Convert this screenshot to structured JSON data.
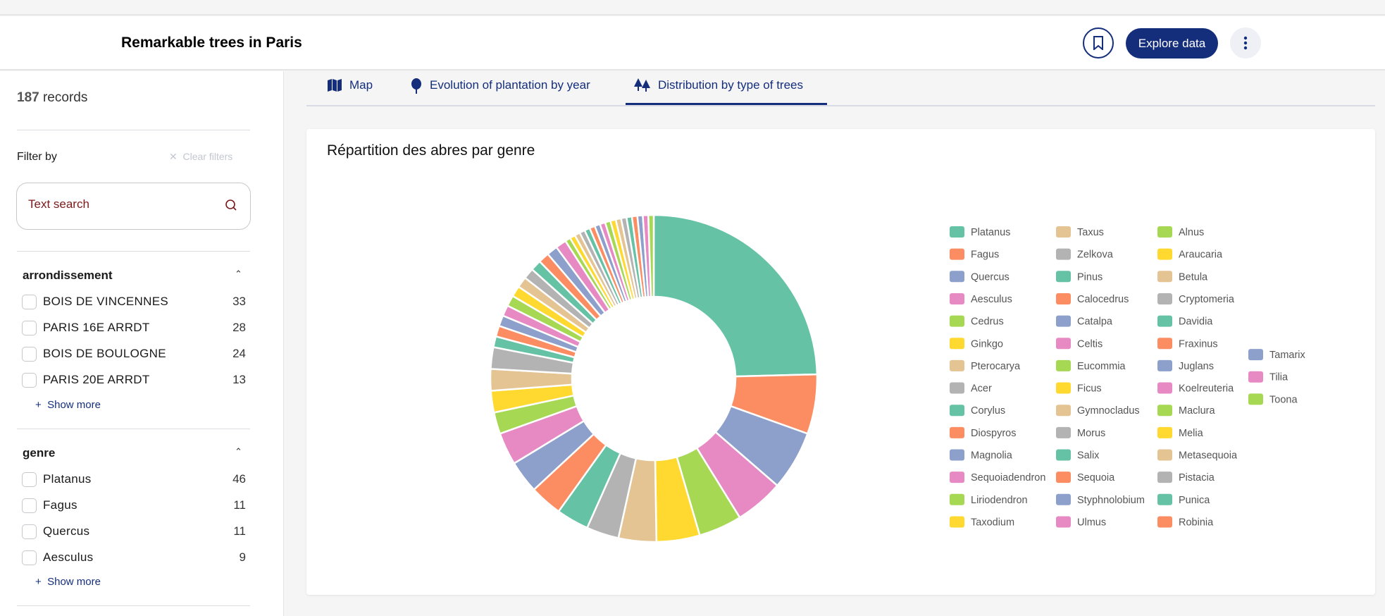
{
  "header": {
    "title": "Remarkable trees in Paris",
    "explore_label": "Explore data",
    "bookmark_icon": "bookmark-icon",
    "more_icon": "more-vertical-icon"
  },
  "sidebar": {
    "records_count": "187",
    "records_label": "records",
    "filter_by": "Filter by",
    "clear_filters": "Clear filters",
    "search_placeholder": "Text search",
    "facets": [
      {
        "title": "arrondissement",
        "items": [
          {
            "label": "BOIS DE VINCENNES",
            "count": "33"
          },
          {
            "label": "PARIS 16E ARRDT",
            "count": "28"
          },
          {
            "label": "BOIS DE BOULOGNE",
            "count": "24"
          },
          {
            "label": "PARIS 20E ARRDT",
            "count": "13"
          }
        ],
        "show_more": "Show more"
      },
      {
        "title": "genre",
        "items": [
          {
            "label": "Platanus",
            "count": "46"
          },
          {
            "label": "Fagus",
            "count": "11"
          },
          {
            "label": "Quercus",
            "count": "11"
          },
          {
            "label": "Aesculus",
            "count": "9"
          }
        ],
        "show_more": "Show more"
      }
    ]
  },
  "tabs": [
    {
      "label": "Map",
      "icon": "map-icon"
    },
    {
      "label": "Evolution of plantation by year",
      "icon": "tree-icon"
    },
    {
      "label": "Distribution by type of trees",
      "icon": "trees-icon",
      "active": true
    }
  ],
  "chart_data": {
    "type": "pie",
    "donut": true,
    "title": "Répartition des abres par genre",
    "legend_position": "right",
    "palette": [
      "#66c2a5",
      "#fc8d62",
      "#8da0cb",
      "#e78ac3",
      "#a6d854",
      "#ffd92f",
      "#e5c494",
      "#b3b3b3"
    ],
    "categories": [
      "Platanus",
      "Fagus",
      "Quercus",
      "Aesculus",
      "Cedrus",
      "Ginkgo",
      "Pterocarya",
      "Acer",
      "Corylus",
      "Diospyros",
      "Magnolia",
      "Sequoiadendron",
      "Liriodendron",
      "Taxodium",
      "Taxus",
      "Zelkova",
      "Pinus",
      "Calocedrus",
      "Catalpa",
      "Celtis",
      "Eucommia",
      "Ficus",
      "Gymnocladus",
      "Morus",
      "Salix",
      "Sequoia",
      "Styphnolobium",
      "Ulmus",
      "Alnus",
      "Araucaria",
      "Betula",
      "Cryptomeria",
      "Davidia",
      "Fraxinus",
      "Juglans",
      "Koelreuteria",
      "Maclura",
      "Melia",
      "Metasequoia",
      "Pistacia",
      "Punica",
      "Robinia",
      "Tamarix",
      "Tilia",
      "Toona"
    ],
    "values": [
      46,
      11,
      11,
      9,
      8,
      8,
      7,
      6,
      6,
      6,
      6,
      6,
      4,
      4,
      4,
      4,
      2,
      2,
      2,
      2,
      2,
      2,
      2,
      2,
      2,
      2,
      2,
      2,
      1,
      1,
      1,
      1,
      1,
      1,
      1,
      1,
      1,
      1,
      1,
      1,
      1,
      1,
      1,
      1,
      1
    ]
  }
}
